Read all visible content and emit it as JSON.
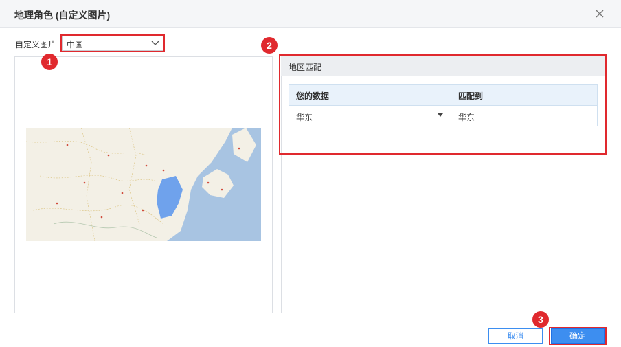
{
  "dialog": {
    "title": "地理角色 (自定义图片)"
  },
  "selector": {
    "label": "自定义图片",
    "value": "中国"
  },
  "region_match": {
    "title": "地区匹配",
    "columns": [
      "您的数据",
      "匹配到"
    ],
    "rows": [
      {
        "your_data": "华东",
        "matched_to": "华东"
      }
    ]
  },
  "buttons": {
    "cancel": "取消",
    "ok": "确定"
  },
  "annotations": [
    "1",
    "2",
    "3"
  ],
  "colors": {
    "accent": "#3d8ef0",
    "highlight": "#e0292e",
    "map_sea": "#a8c4e2",
    "map_land": "#f3f0e6",
    "map_region": "#6fa2ec"
  },
  "icons": {
    "close": "close-icon",
    "dropdown": "chevron-down-icon",
    "map": "map-image"
  }
}
